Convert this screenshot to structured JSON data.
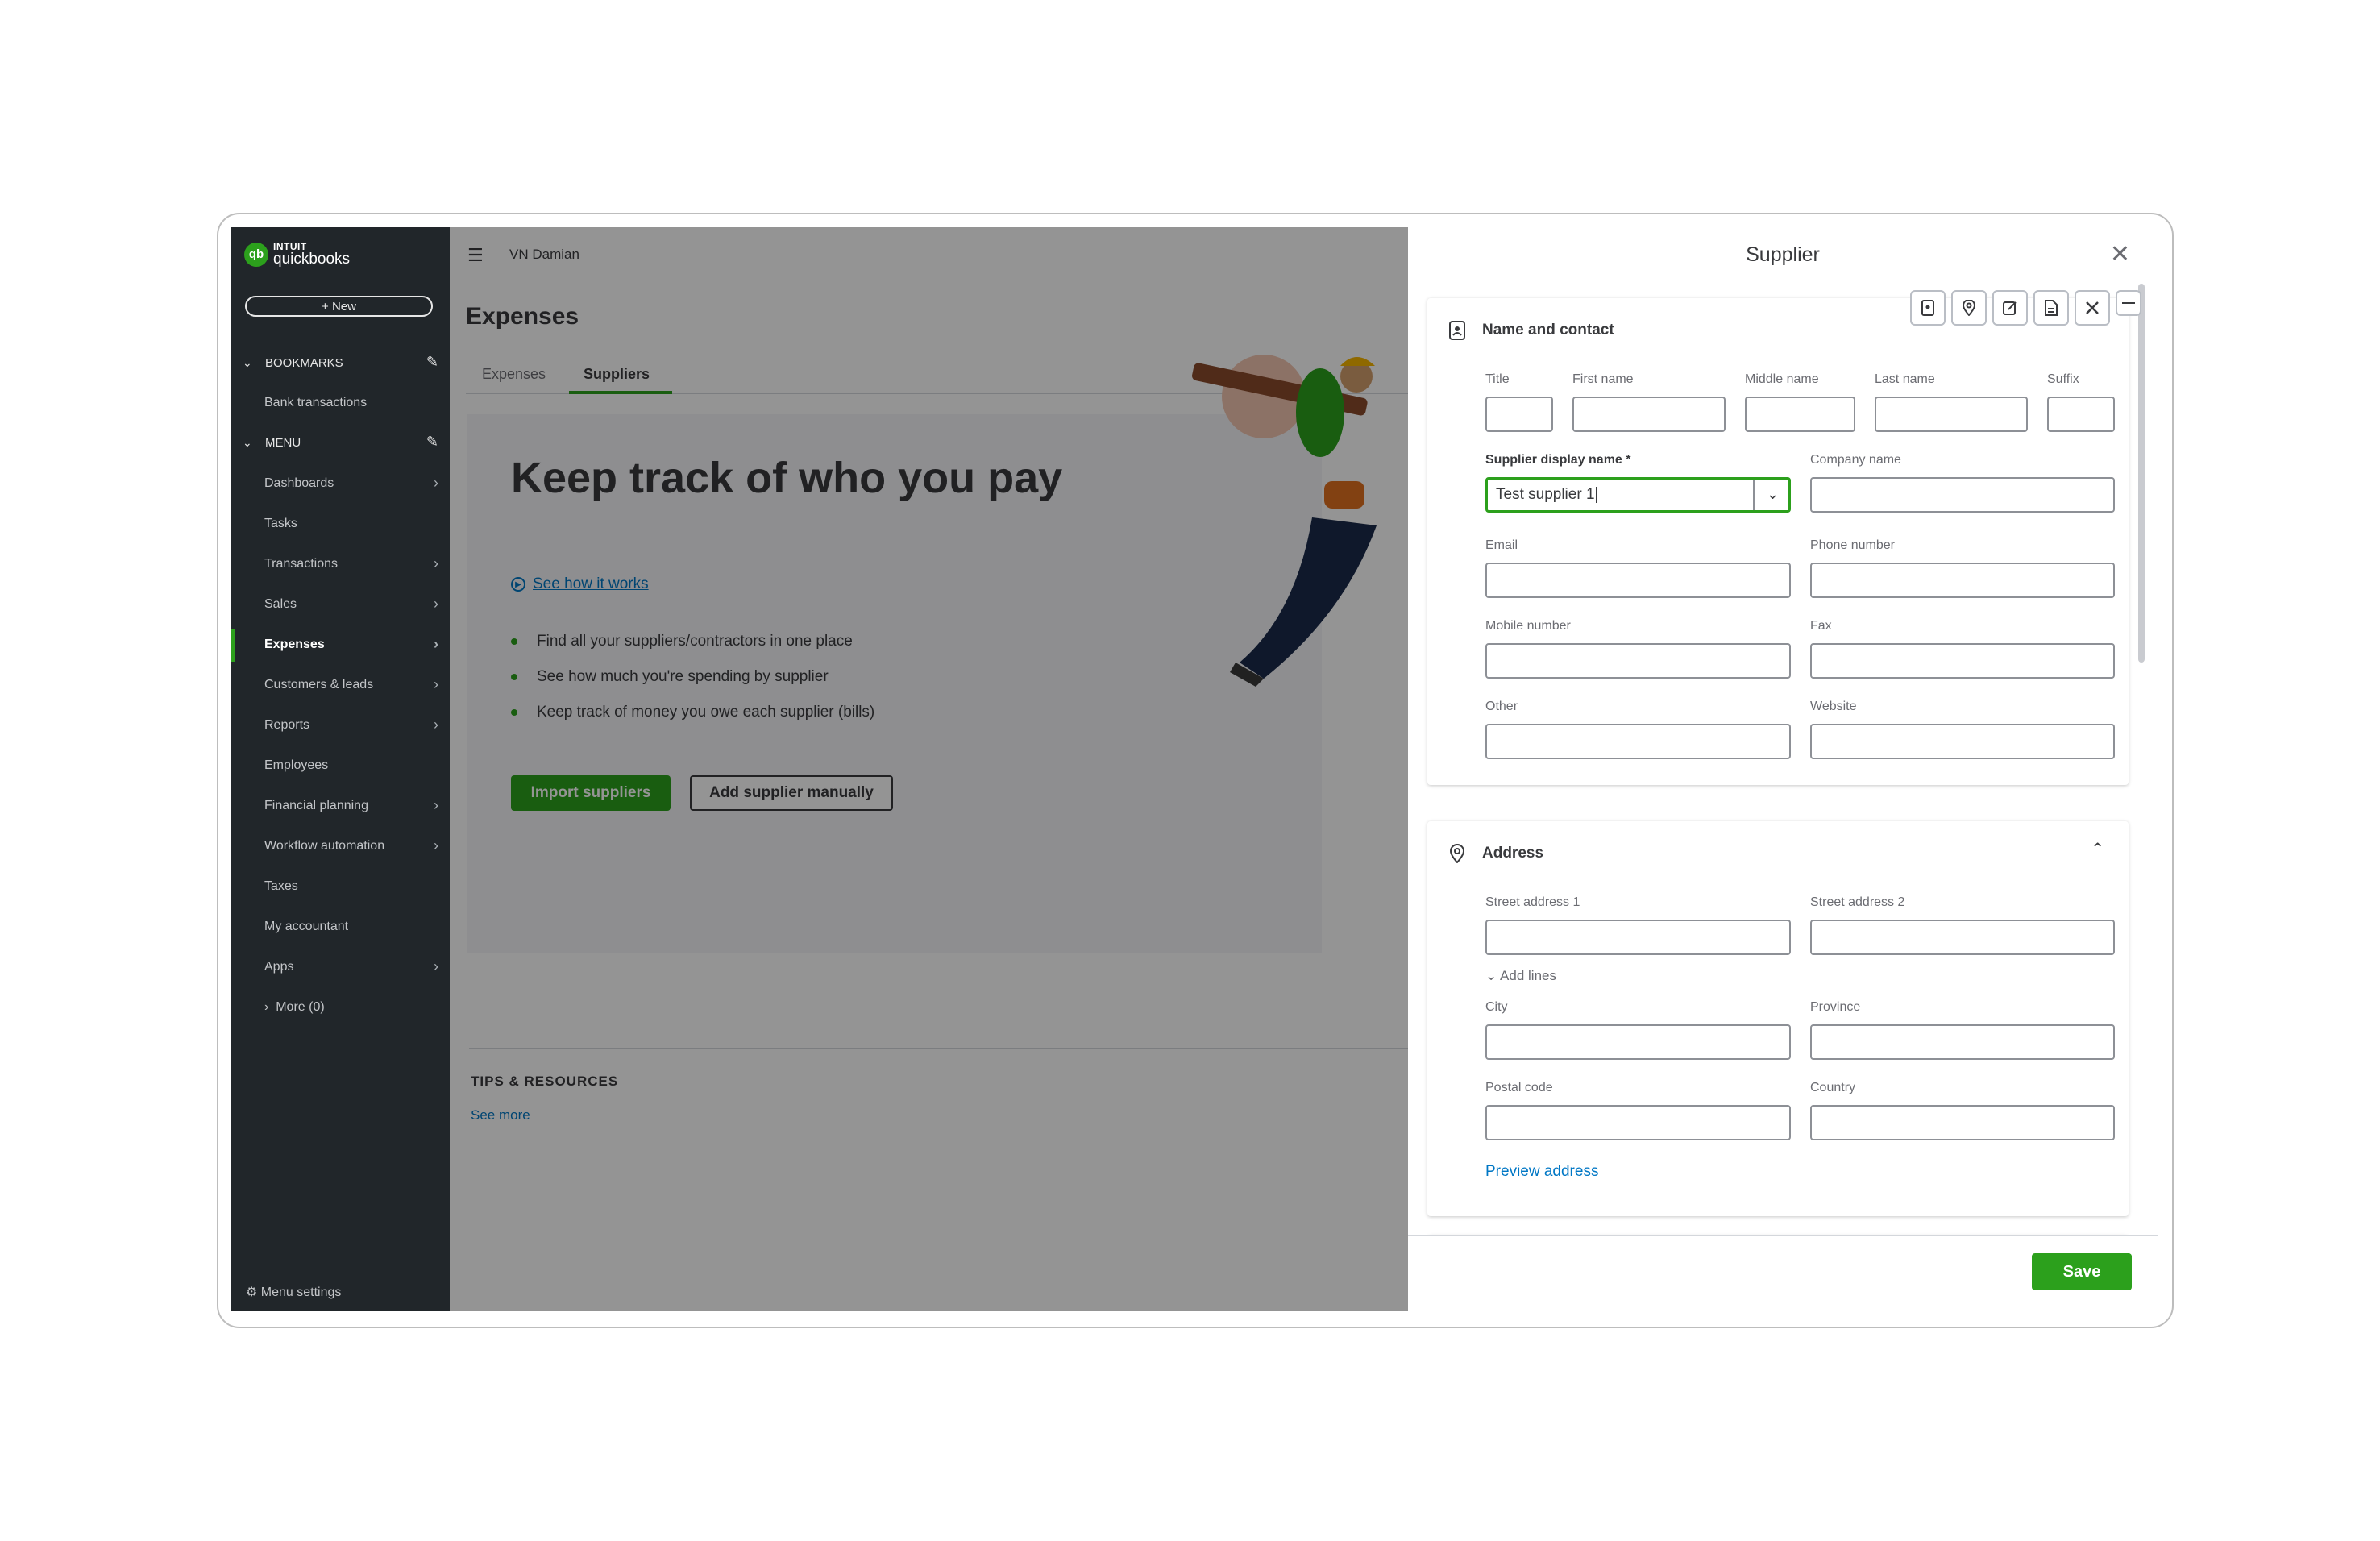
{
  "sidebar": {
    "logo_top": "INTUIT",
    "logo_main": "quickbooks",
    "new_label": "+ New",
    "bookmarks_head": "BOOKMARKS",
    "bookmarks": [
      "Bank transactions"
    ],
    "menu_head": "MENU",
    "menu_items": [
      {
        "label": "Dashboards"
      },
      {
        "label": "Tasks"
      },
      {
        "label": "Transactions"
      },
      {
        "label": "Sales"
      },
      {
        "label": "Expenses"
      },
      {
        "label": "Customers & leads"
      },
      {
        "label": "Reports"
      },
      {
        "label": "Employees"
      },
      {
        "label": "Financial planning"
      },
      {
        "label": "Workflow automation"
      },
      {
        "label": "Taxes"
      },
      {
        "label": "My accountant"
      },
      {
        "label": "Apps"
      }
    ],
    "more_label": "More (0)",
    "menu_settings": "Menu settings"
  },
  "main": {
    "company": "VN Damian",
    "page_title": "Expenses",
    "tabs": [
      "Expenses",
      "Suppliers"
    ],
    "active_tab": "Suppliers",
    "hero_title": "Keep track of who you pay",
    "see_how": "See how it works",
    "bullets": [
      "Find all your suppliers/contractors in one place",
      "See how much you're spending by supplier",
      "Keep track of money you owe each supplier (bills)"
    ],
    "import_btn": "Import suppliers",
    "manual_btn": "Add supplier manually",
    "tips_title": "TIPS & RESOURCES",
    "see_more": "See more"
  },
  "panel": {
    "title": "Supplier",
    "name_section": "Name and contact",
    "labels": {
      "title": "Title",
      "first": "First name",
      "middle": "Middle name",
      "last": "Last name",
      "suffix": "Suffix",
      "display": "Supplier display name *",
      "company": "Company name",
      "email": "Email",
      "phone": "Phone number",
      "mobile": "Mobile number",
      "fax": "Fax",
      "other": "Other",
      "website": "Website"
    },
    "display_value": "Test supplier 1",
    "address_section": "Address",
    "addr_labels": {
      "street1": "Street address 1",
      "street2": "Street address 2",
      "city": "City",
      "province": "Province",
      "postal": "Postal code",
      "country": "Country"
    },
    "add_lines": "Add lines",
    "preview_address": "Preview address",
    "save": "Save"
  },
  "colors": {
    "brand_green": "#2ca01c",
    "link_blue": "#0077c5",
    "sidebar_bg": "#21262a"
  }
}
